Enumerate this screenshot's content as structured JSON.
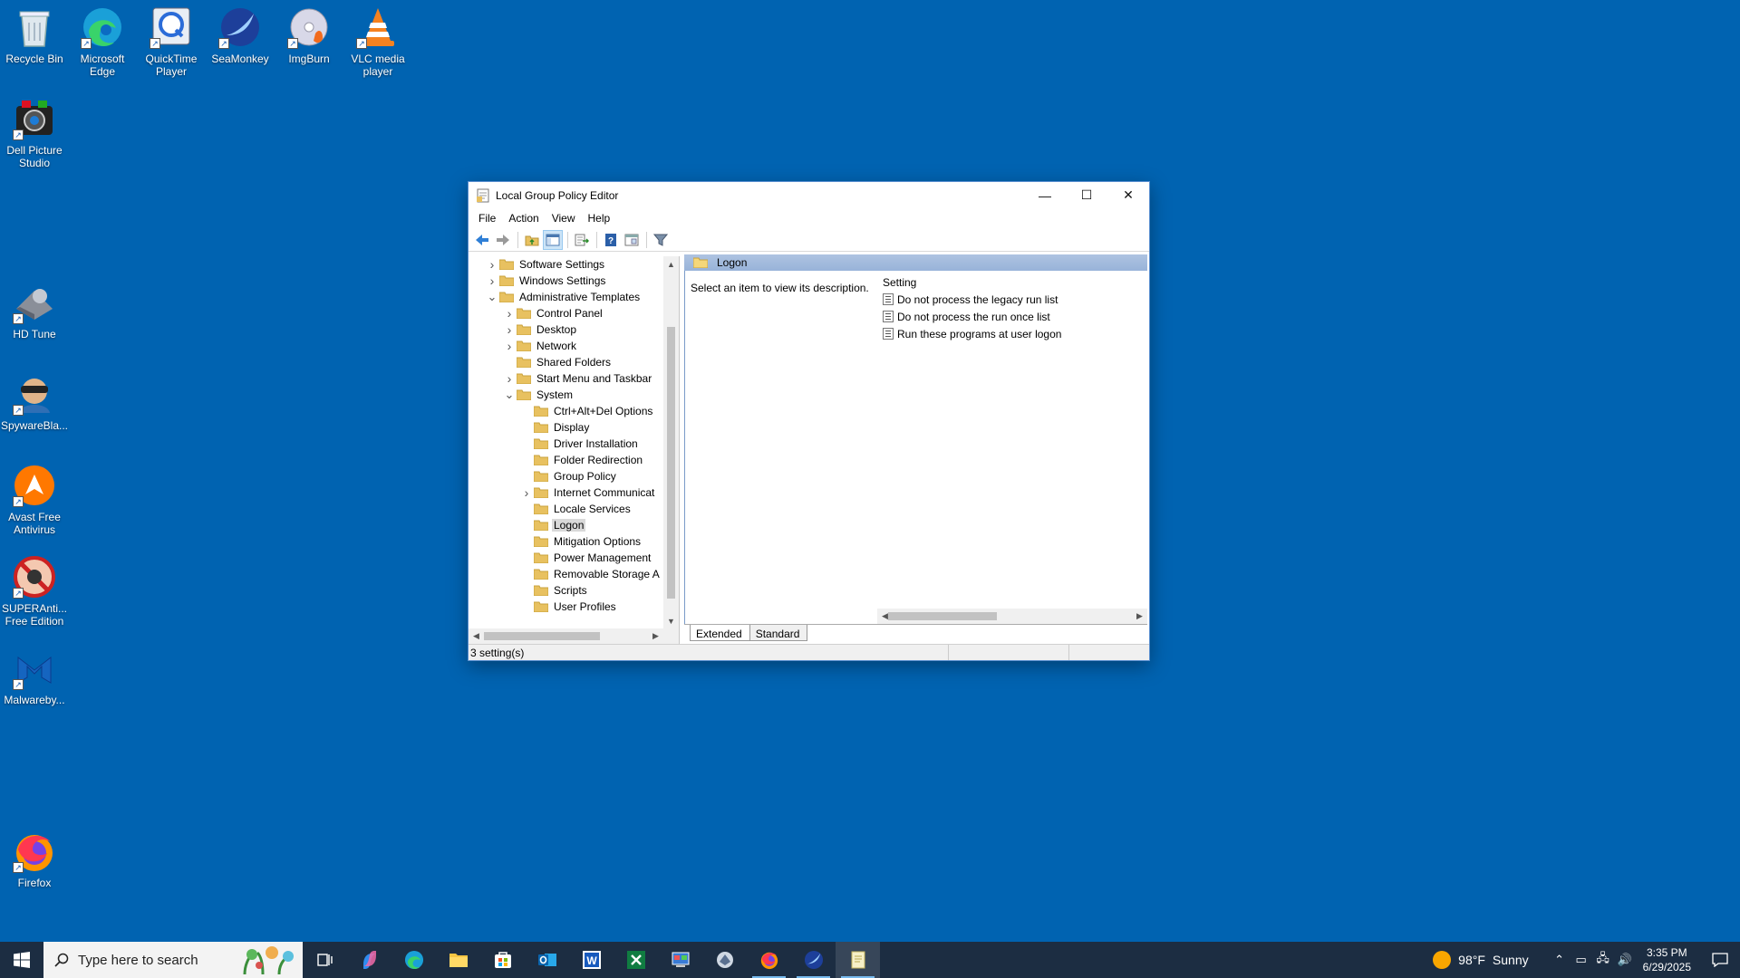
{
  "desktop": {
    "icons": [
      {
        "label": "Recycle Bin",
        "icon": "recycle-bin-icon"
      },
      {
        "label": "Microsoft Edge",
        "icon": "edge-icon"
      },
      {
        "label": "QuickTime Player",
        "icon": "quicktime-icon"
      },
      {
        "label": "SeaMonkey",
        "icon": "seamonkey-icon"
      },
      {
        "label": "ImgBurn",
        "icon": "imgburn-icon"
      },
      {
        "label": "VLC media player",
        "icon": "vlc-icon"
      },
      {
        "label": "Dell Picture Studio",
        "icon": "dell-picture-studio-icon"
      },
      {
        "label": "HD Tune",
        "icon": "hd-tune-icon"
      },
      {
        "label": "SpywareBla...",
        "icon": "spywareblaster-icon"
      },
      {
        "label": "Avast Free Antivirus",
        "icon": "avast-icon"
      },
      {
        "label": "SUPERAnti... Free Edition",
        "icon": "superantispyware-icon"
      },
      {
        "label": "Malwareby...",
        "icon": "malwarebytes-icon"
      },
      {
        "label": "Firefox",
        "icon": "firefox-icon"
      }
    ]
  },
  "window": {
    "title": "Local Group Policy Editor",
    "controls": {
      "minimize": "—",
      "maximize": "☐",
      "close": "✕"
    },
    "menu": [
      "File",
      "Action",
      "View",
      "Help"
    ],
    "toolbar": [
      "back",
      "forward",
      "up-folder",
      "show-hide-tree",
      "export-list",
      "help",
      "properties",
      "filter"
    ],
    "tree": [
      {
        "label": "Software Settings",
        "level": 0,
        "expander": "collapsed"
      },
      {
        "label": "Windows Settings",
        "level": 0,
        "expander": "collapsed"
      },
      {
        "label": "Administrative Templates",
        "level": 0,
        "expander": "expanded"
      },
      {
        "label": "Control Panel",
        "level": 1,
        "expander": "collapsed"
      },
      {
        "label": "Desktop",
        "level": 1,
        "expander": "collapsed"
      },
      {
        "label": "Network",
        "level": 1,
        "expander": "collapsed"
      },
      {
        "label": "Shared Folders",
        "level": 1,
        "expander": "none"
      },
      {
        "label": "Start Menu and Taskbar",
        "level": 1,
        "expander": "collapsed"
      },
      {
        "label": "System",
        "level": 1,
        "expander": "expanded"
      },
      {
        "label": "Ctrl+Alt+Del Options",
        "level": 2,
        "expander": "none"
      },
      {
        "label": "Display",
        "level": 2,
        "expander": "none"
      },
      {
        "label": "Driver Installation",
        "level": 2,
        "expander": "none"
      },
      {
        "label": "Folder Redirection",
        "level": 2,
        "expander": "none"
      },
      {
        "label": "Group Policy",
        "level": 2,
        "expander": "none"
      },
      {
        "label": "Internet Communicat",
        "level": 2,
        "expander": "collapsed"
      },
      {
        "label": "Locale Services",
        "level": 2,
        "expander": "none"
      },
      {
        "label": "Logon",
        "level": 2,
        "expander": "none",
        "selected": true
      },
      {
        "label": "Mitigation Options",
        "level": 2,
        "expander": "none"
      },
      {
        "label": "Power Management",
        "level": 2,
        "expander": "none"
      },
      {
        "label": "Removable Storage A",
        "level": 2,
        "expander": "none"
      },
      {
        "label": "Scripts",
        "level": 2,
        "expander": "none"
      },
      {
        "label": "User Profiles",
        "level": 2,
        "expander": "none"
      }
    ],
    "right_pane": {
      "header": "Logon",
      "description": "Select an item to view its description.",
      "column_header": "Setting",
      "settings": [
        "Do not process the legacy run list",
        "Do not process the run once list",
        "Run these programs at user logon"
      ],
      "tabs": [
        "Extended",
        "Standard"
      ],
      "active_tab": "Extended"
    },
    "status": "3 setting(s)"
  },
  "taskbar": {
    "search_placeholder": "Type here to search",
    "apps": [
      "task-view",
      "copilot",
      "edge",
      "file-explorer",
      "store",
      "outlook",
      "word",
      "excel",
      "control-panel",
      "app-misc",
      "firefox",
      "seamonkey",
      "notepad"
    ],
    "weather": {
      "temp": "98°F",
      "condition": "Sunny"
    },
    "time": "3:35 PM",
    "date": "6/29/2025"
  },
  "colors": {
    "desktop": "#0063b1",
    "taskbar": "#1c2d42",
    "folder": "#e8c160",
    "selection": "#d9d9d9",
    "pane_header": "#aec3e1"
  }
}
